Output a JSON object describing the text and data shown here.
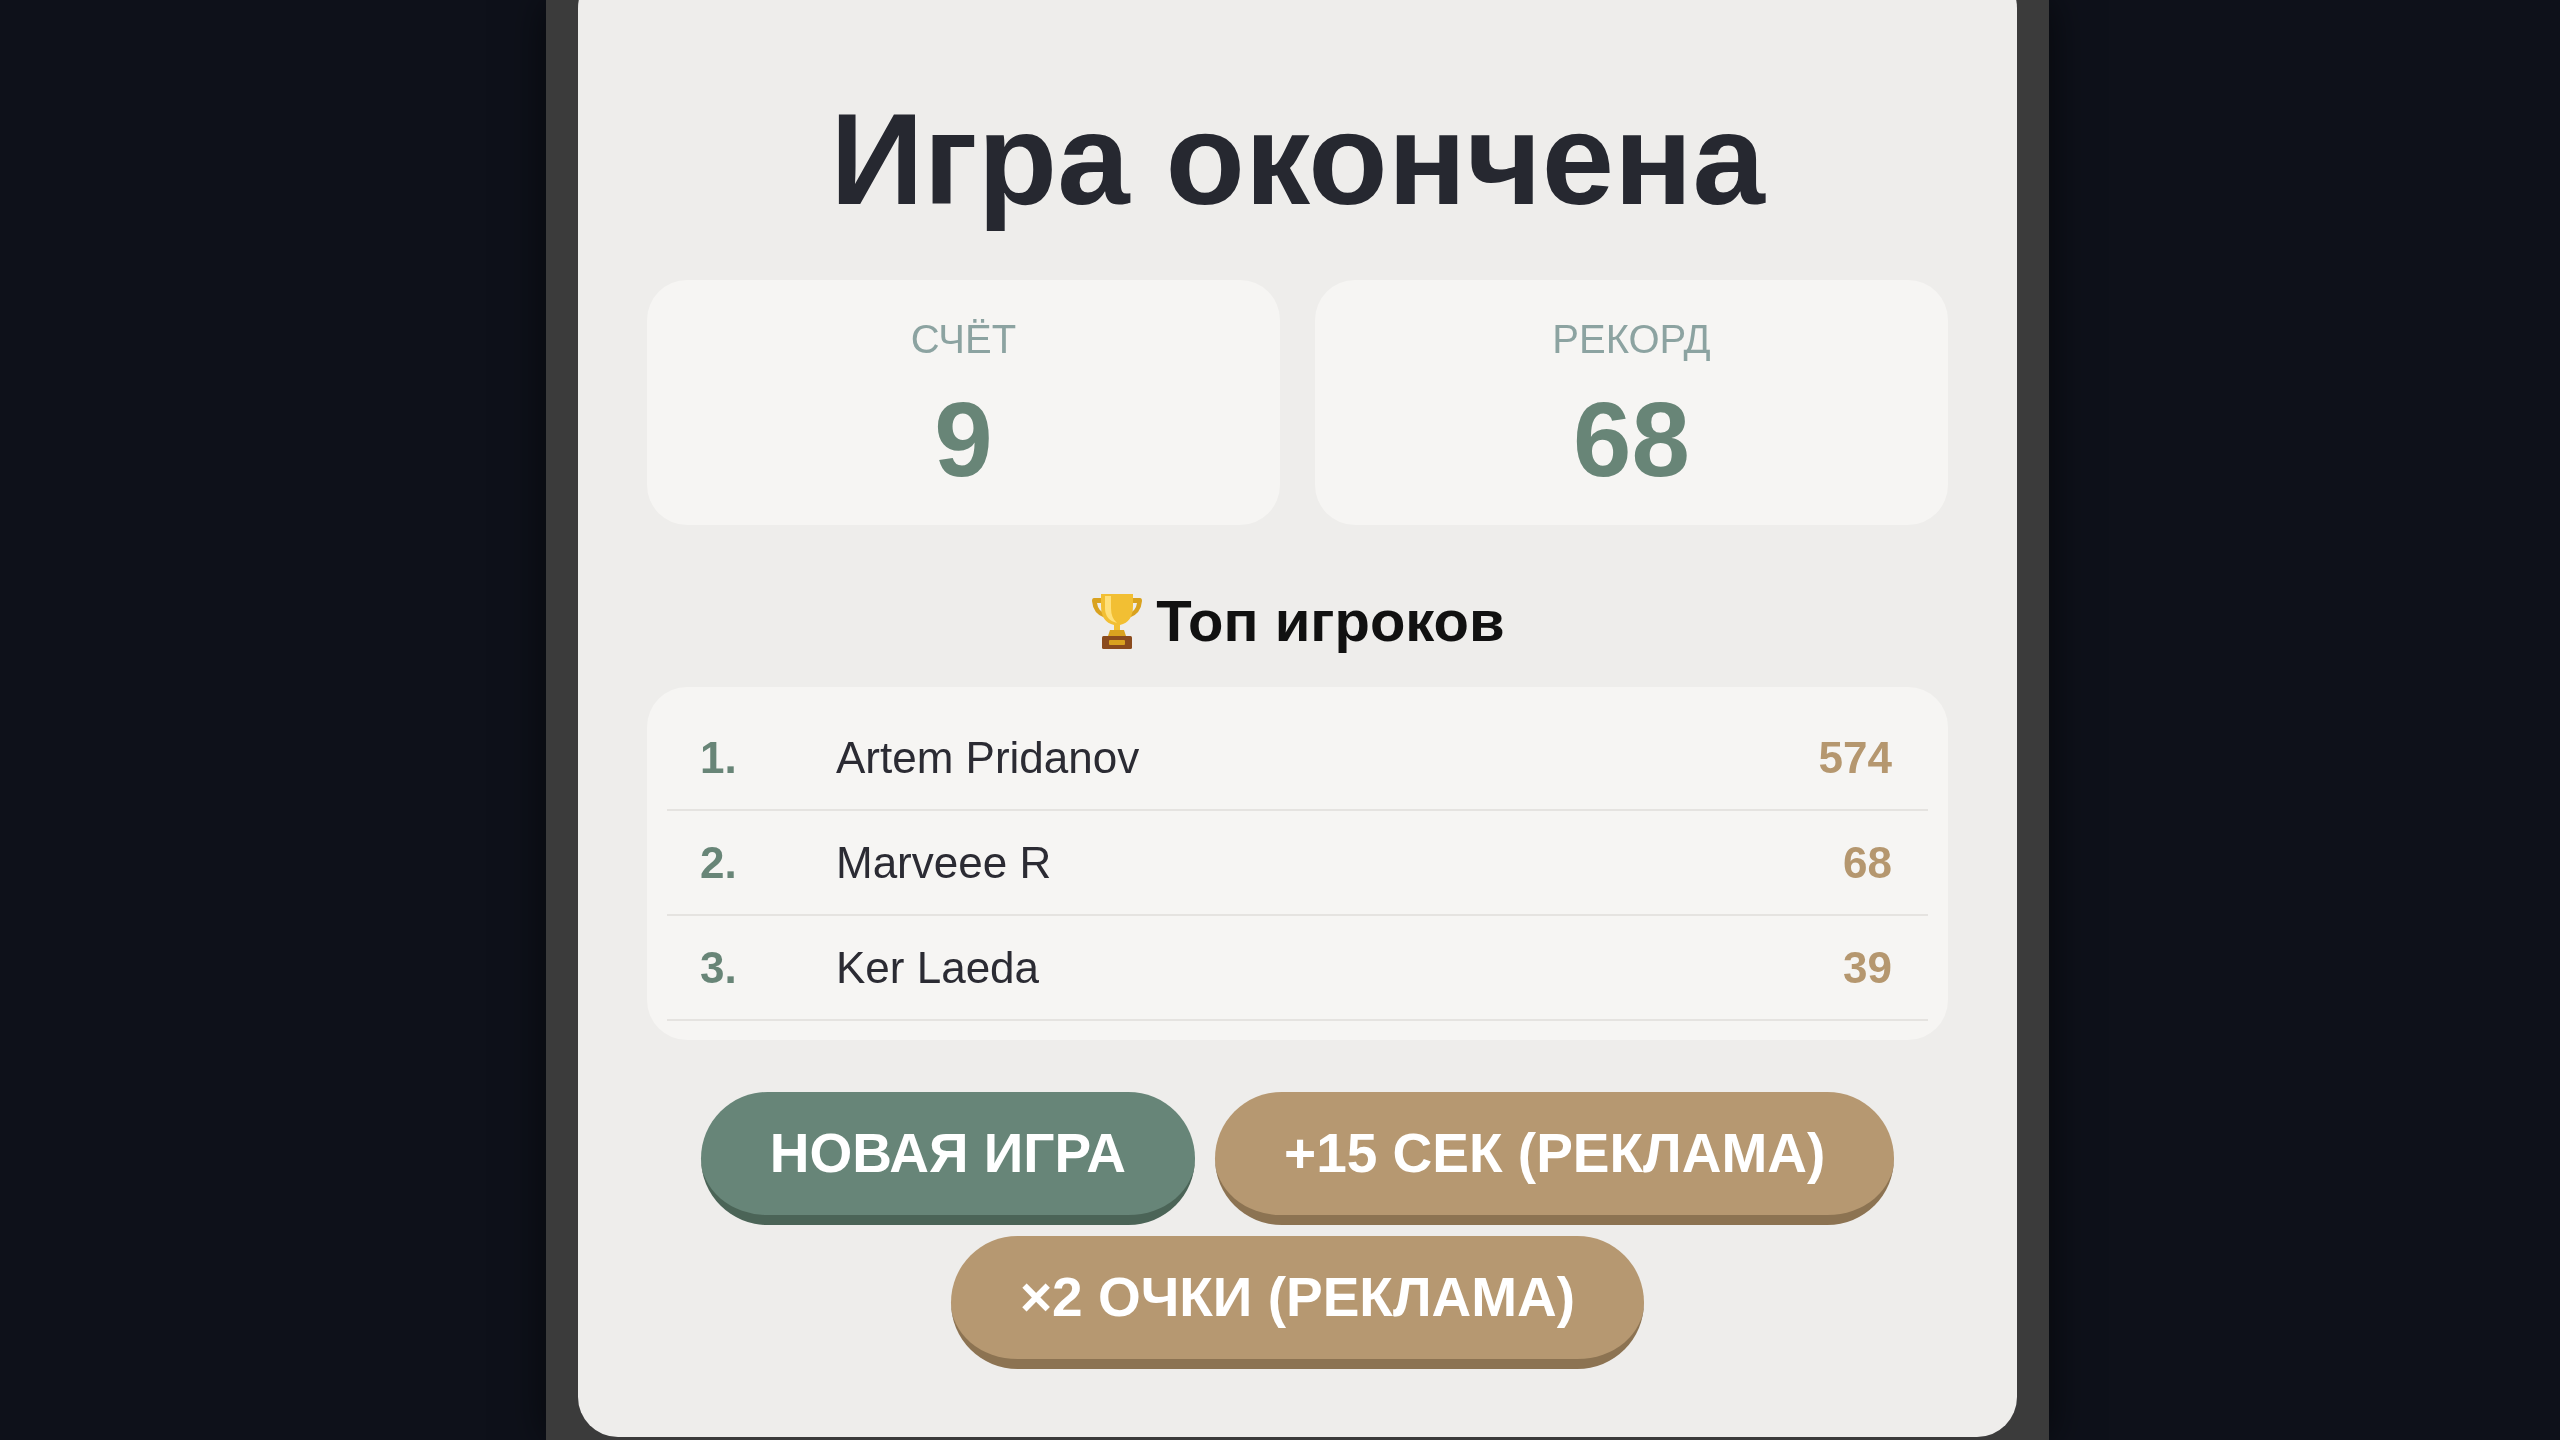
{
  "title": "Игра окончена",
  "stats": [
    {
      "label": "СЧЁТ",
      "value": "9"
    },
    {
      "label": "РЕКОРД",
      "value": "68"
    }
  ],
  "leaderboard": {
    "title": "Топ игроков",
    "rows": [
      {
        "rank": "1.",
        "name": "Artem Pridanov",
        "score": "574"
      },
      {
        "rank": "2.",
        "name": "Marveee R",
        "score": "68"
      },
      {
        "rank": "3.",
        "name": "Ker Laeda",
        "score": "39"
      }
    ]
  },
  "buttons": [
    {
      "label": "НОВАЯ ИГРА",
      "kind": "primary"
    },
    {
      "label": "+15 СЕК (РЕКЛАМА)",
      "kind": "ad"
    },
    {
      "label": "×2 ОЧКИ (РЕКЛАМА)",
      "kind": "ad"
    }
  ]
}
